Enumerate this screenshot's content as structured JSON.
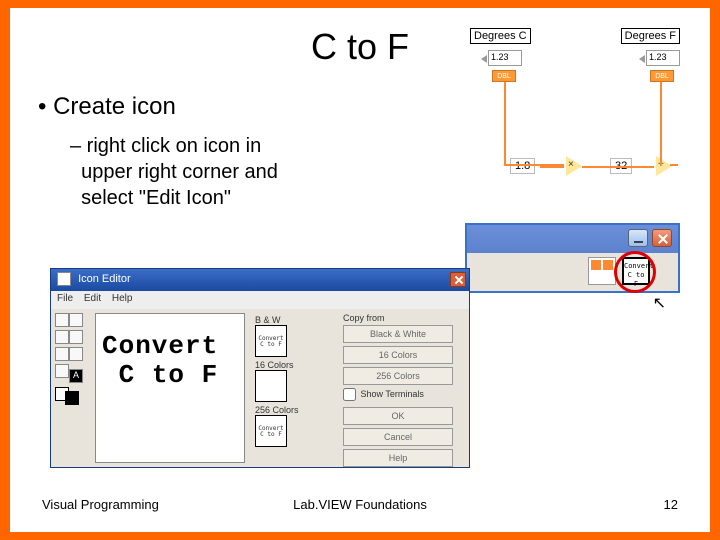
{
  "title": "C to F",
  "bullet1": "• Create icon",
  "bullet2": "– right click on icon in\n  upper right corner and\n  select \"Edit Icon\"",
  "footer": {
    "left": "Visual Programming",
    "center": "Lab.VIEW Foundations",
    "right": "12"
  },
  "diagram": {
    "labelC": "Degrees C",
    "labelF": "Degrees F",
    "num1": "1.23",
    "num2": "1.23",
    "dbl": "DBL",
    "const1": "1.8",
    "const2": "32",
    "op1": "×",
    "op2": "+"
  },
  "corner": {
    "iconText": "Convert\nC to F"
  },
  "editor": {
    "title": "Icon Editor",
    "menu": "File  Edit  Help",
    "canvas_line1": "Convert",
    "canvas_line2": "C to F",
    "bw_label": "B & W",
    "c16_label": "16 Colors",
    "c256_label": "256 Colors",
    "copy_from": "Copy from",
    "btn_bw": "Black & White",
    "btn_16": "16 Colors",
    "btn_256": "256 Colors",
    "show_term": "Show Terminals",
    "ok": "OK",
    "cancel": "Cancel",
    "help": "Help"
  }
}
